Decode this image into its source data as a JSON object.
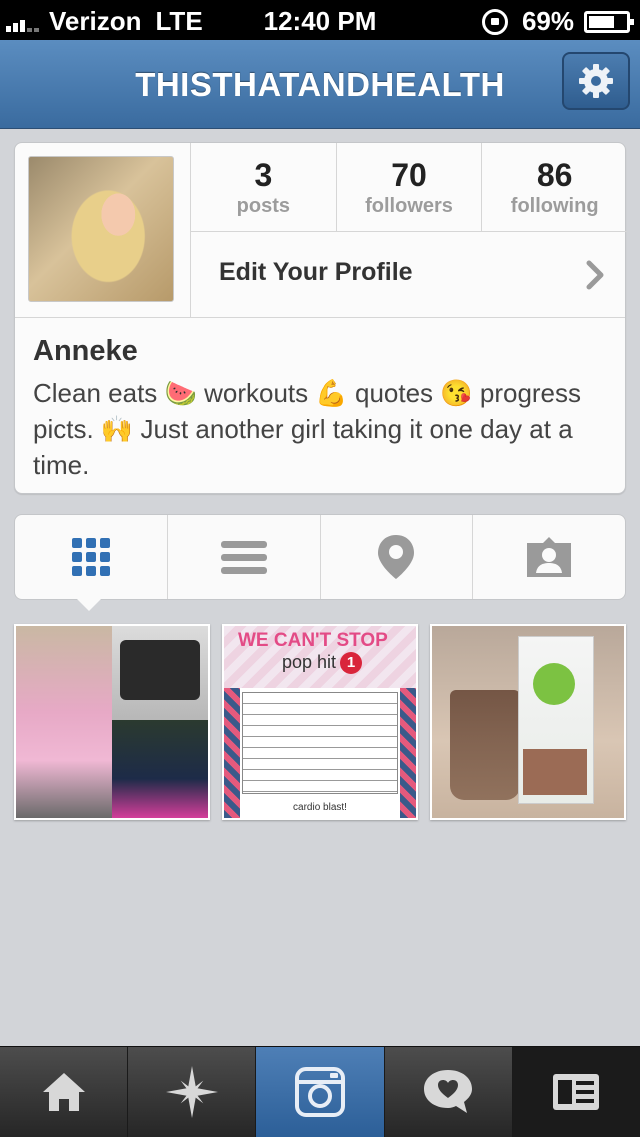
{
  "status_bar": {
    "carrier": "Verizon",
    "network": "LTE",
    "time": "12:40 PM",
    "battery": "69%",
    "battery_level": 0.69,
    "icons": [
      "signal-icon",
      "rotation-lock-icon",
      "battery-icon"
    ]
  },
  "navbar": {
    "title": "THISTHATANDHEALTH",
    "settings_icon": "gear-icon"
  },
  "profile": {
    "stats": [
      {
        "value": "3",
        "label": "posts"
      },
      {
        "value": "70",
        "label": "followers"
      },
      {
        "value": "86",
        "label": "following"
      }
    ],
    "edit_label": "Edit Your Profile",
    "name": "Anneke",
    "bio": "Clean eats 🍉 workouts 💪 quotes 😘 progress picts. 🙌 Just another girl taking it one day at a time."
  },
  "view_tabs": [
    {
      "icon": "grid-icon",
      "selected": true
    },
    {
      "icon": "list-icon",
      "selected": false
    },
    {
      "icon": "location-pin-icon",
      "selected": false
    },
    {
      "icon": "tagged-person-icon",
      "selected": false
    }
  ],
  "thumbnail_text": {
    "t2_title": "WE CAN'T STOP",
    "t2_subtitle": "pop hit",
    "t2_badge": "1",
    "t2_footer": "cardio blast!"
  },
  "tab_bar": [
    {
      "icon": "home-icon",
      "active": false
    },
    {
      "icon": "explore-star-icon",
      "active": false
    },
    {
      "icon": "camera-icon",
      "active": true
    },
    {
      "icon": "news-heart-bubble-icon",
      "active": false
    },
    {
      "icon": "profile-card-icon",
      "active": false
    }
  ],
  "colors": {
    "nav_blue": "#3a6b9f",
    "active_tab": "#2c5f98",
    "grid_icon_blue": "#3170b4",
    "background": "#d2d4d8"
  }
}
